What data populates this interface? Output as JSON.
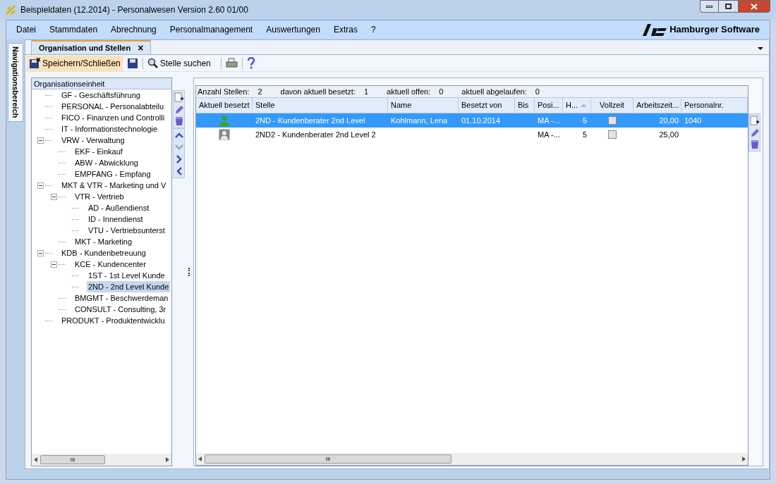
{
  "window": {
    "title": "Beispieldaten (12.2014) - Personalwesen Version 2.60 01/00"
  },
  "menu": [
    "Datei",
    "Stammdaten",
    "Abrechnung",
    "Personalmanagement",
    "Auswertungen",
    "Extras",
    "?"
  ],
  "brand": "Hamburger Software",
  "nav_strip": "Navigationsbereich",
  "tabs": [
    {
      "label": "Organisation und Stellen",
      "selected": true,
      "close": "×"
    }
  ],
  "toolbar": {
    "save_close": "Speichern/Schließen",
    "search": "Stelle suchen"
  },
  "tree": {
    "header": "Organisationseinheit",
    "items": [
      {
        "label": "GF - Geschäftsführung",
        "selected": false
      },
      {
        "label": "PERSONAL - Personalabteilu",
        "selected": false
      },
      {
        "label": "FICO - Finanzen und Controlli",
        "selected": false
      },
      {
        "label": "IT - Informationstechnologie",
        "selected": false
      },
      {
        "label": "VRW - Verwaltung",
        "selected": false,
        "expanded": true,
        "children": [
          {
            "label": "EKF - Einkauf",
            "selected": false
          },
          {
            "label": "ABW - Abwicklung",
            "selected": false
          },
          {
            "label": "EMPFANG - Empfang",
            "selected": false
          }
        ]
      },
      {
        "label": "MKT & VTR - Marketing und V",
        "selected": false,
        "expanded": true,
        "children": [
          {
            "label": "VTR - Vertrieb",
            "selected": false,
            "expanded": true,
            "children": [
              {
                "label": "AD - Außendienst",
                "selected": false
              },
              {
                "label": "ID - Innendienst",
                "selected": false
              },
              {
                "label": "VTU - Vertriebsunterst",
                "selected": false
              }
            ]
          },
          {
            "label": "MKT - Marketing",
            "selected": false
          }
        ]
      },
      {
        "label": "KDB - Kundenbetreuung",
        "selected": false,
        "expanded": true,
        "children": [
          {
            "label": "KCE - Kundencenter",
            "selected": false,
            "expanded": true,
            "children": [
              {
                "label": "1ST - 1st Level Kunde",
                "selected": false
              },
              {
                "label": "2ND - 2nd Level Kunde",
                "selected": true
              }
            ]
          },
          {
            "label": "BMGMT - Beschwerdeman",
            "selected": false
          },
          {
            "label": "CONSULT - Consulting, 3r",
            "selected": false
          }
        ]
      },
      {
        "label": "PRODUKT - Produktentwicklu",
        "selected": false
      }
    ],
    "scroll_grip": "III"
  },
  "summary": [
    {
      "label": "Anzahl Stellen:",
      "value": "2"
    },
    {
      "label": "davon aktuell besetzt:",
      "value": "1"
    },
    {
      "label": "aktuell offen:",
      "value": "0"
    },
    {
      "label": "aktuell abgelaufen:",
      "value": "0"
    }
  ],
  "table": {
    "columns": [
      "Aktuell besetzt",
      "Stelle",
      "Name",
      "Besetzt von",
      "Bis",
      "Posi...",
      "H...",
      "Vollzeit",
      "Arbeitszeit...",
      "Personalnr."
    ],
    "rows": [
      {
        "selected": true,
        "occupied": true,
        "stelle": "2ND - Kundenberater 2nd Level",
        "name": "Kohlmann, Lena",
        "von": "01.10.2014",
        "posi": "MA -...",
        "h": "5",
        "vollzeit": false,
        "arbeitszeit": "20,00",
        "personalnr": "1040"
      },
      {
        "selected": false,
        "occupied": false,
        "stelle": "2ND2 - Kundenberater 2nd Level 2",
        "posi": "MA -...",
        "h": "5",
        "vollzeit": false,
        "arbeitszeit": "25,00"
      }
    ],
    "scroll_grip": "III"
  }
}
